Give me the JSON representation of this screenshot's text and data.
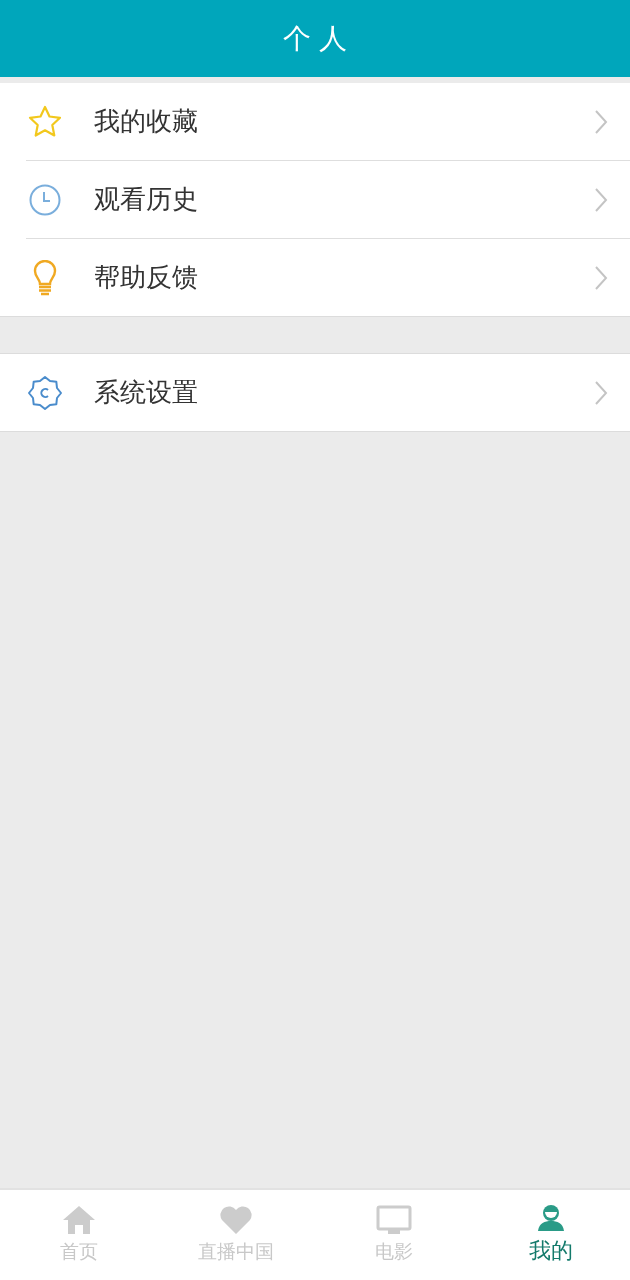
{
  "header": {
    "title": "个 人"
  },
  "menu_groups": [
    {
      "items": [
        {
          "label": "我的收藏",
          "kind": "star",
          "color": "#f2c81d"
        },
        {
          "label": "观看历史",
          "kind": "clock",
          "color": "#7aaedc"
        },
        {
          "label": "帮助反馈",
          "kind": "bulb",
          "color": "#f0a922"
        }
      ]
    },
    {
      "items": [
        {
          "label": "系统设置",
          "kind": "gear",
          "color": "#4a8ccc"
        }
      ]
    }
  ],
  "tab_bar": [
    {
      "label": "首页",
      "kind": "home",
      "selected": false
    },
    {
      "label": "直播中国",
      "kind": "heart",
      "selected": false
    },
    {
      "label": "电影",
      "kind": "tv",
      "selected": false
    },
    {
      "label": "我的",
      "kind": "person",
      "selected": true
    }
  ]
}
